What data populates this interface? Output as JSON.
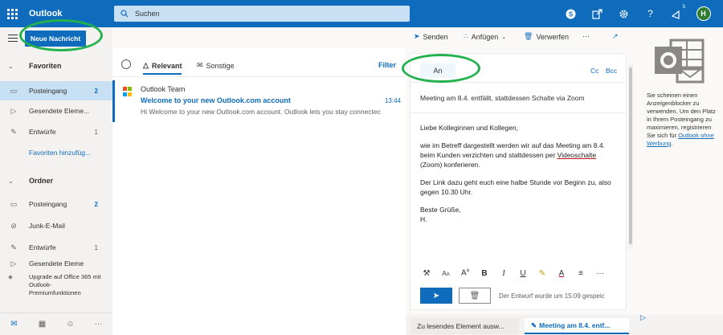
{
  "topbar": {
    "app_name": "Outlook",
    "search_placeholder": "Suchen",
    "notification_count": "5",
    "avatar_initial": "H"
  },
  "leftnav": {
    "new_message": "Neue Nachricht",
    "favorites": {
      "header": "Favoriten",
      "items": [
        {
          "label": "Posteingang",
          "count": "2"
        },
        {
          "label": "Gesendete Eleme...",
          "count": ""
        },
        {
          "label": "Entwürfe",
          "count": "1"
        }
      ],
      "add_link": "Favoriten hinzufüg..."
    },
    "folders": {
      "header": "Ordner",
      "items": [
        {
          "label": "Posteingang",
          "count": "2"
        },
        {
          "label": "Junk-E-Mail",
          "count": ""
        },
        {
          "label": "Entwürfe",
          "count": "1"
        },
        {
          "label": "Gesendete Eleme",
          "count": ""
        }
      ]
    },
    "upgrade": "Upgrade auf Office 365 mit Outlook-Premiumfunktionen"
  },
  "commandbar": {
    "send": "Senden",
    "attach": "Anfügen",
    "discard": "Verwerfen",
    "more": "···"
  },
  "msglist": {
    "tab_relevant": "Relevant",
    "tab_other": "Sonstige",
    "filter": "Filter",
    "message": {
      "from": "Outlook Team",
      "subject": "Welcome to your new Outlook.com account",
      "time": "13:44",
      "preview": "Hi Welcome to your new Outlook.com account. Outlook lets you stay connectec"
    }
  },
  "compose": {
    "to_label": "An",
    "cc": "Cc",
    "bcc": "Bcc",
    "subject": "Meeting am 8.4. entfällt, stattdessen Schalte via Zoom",
    "greeting": "Liebe Kolleginnen und Kollegen,",
    "para1_a": "wie im Betreff dargestellt werden wir auf das Meeting am 8.4. beim Kunden verzichten und stattdessen per ",
    "para1_underlined": "Videoschalte",
    "para1_b": " (Zoom) konferieren.",
    "para2": "Der Link dazu geht euch eine halbe Stunde vor Beginn zu, also gegen 10.30 Uhr.",
    "closing": "Beste Grüße,",
    "signature": "H.",
    "draft_status": "Der Entwurf wurde um 15:09 gespeic"
  },
  "bottom_tabs": {
    "inactive": "Zu lesendes Element ausw...",
    "active": "Meeting am 8.4. entf..."
  },
  "adpane": {
    "text_before_link": "Sie scheinen einen Anzeigenblocker zu verwenden. Um den Platz in Ihrem Posteingang zu maximieren, registrieren Sie sich für ",
    "link": "Outlook ohne Werbung",
    "text_after_link": "."
  },
  "colors": {
    "brand": "#0f6cbd",
    "annotation": "#22b14c"
  }
}
